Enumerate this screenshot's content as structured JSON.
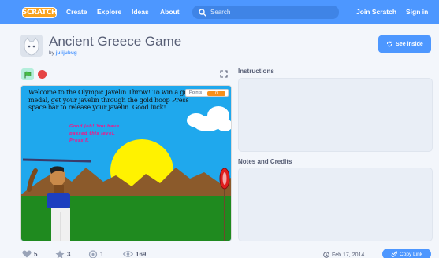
{
  "nav": {
    "logo": "SCRATCH",
    "links": [
      "Create",
      "Explore",
      "Ideas",
      "About"
    ],
    "search_placeholder": "Search",
    "join": "Join Scratch",
    "signin": "Sign in"
  },
  "project": {
    "title": "Ancient Greece Game",
    "by_prefix": "by",
    "author": "julijubug",
    "see_inside": "See inside"
  },
  "stage": {
    "game_text": "Welcome to the Olympic Javelin Throw! To win a gold medal, get your javelin through the gold hoop Press space bar to release your javelin. Good luck!",
    "message_lines": [
      "Good job! You have",
      "passed this level.",
      "Press F."
    ],
    "points_label": "Points",
    "points_value": "0"
  },
  "sidebar": {
    "instructions_title": "Instructions",
    "notes_title": "Notes and Credits"
  },
  "stats": {
    "loves": "5",
    "favorites": "3",
    "remixes": "1",
    "views": "169",
    "date": "Feb 17, 2014",
    "copy_link": "Copy Link"
  },
  "colors": {
    "brand_blue": "#4d97ff",
    "logo_orange": "#f9a21e",
    "panel": "#e9eef6",
    "sky": "#1fa8ed",
    "grass": "#1f8a1f",
    "sun": "#fff200",
    "mountains": "#8b5a2b"
  },
  "icons": [
    "search-icon",
    "see-inside-icon",
    "green-flag-icon",
    "stop-icon",
    "fullscreen-icon",
    "heart-icon",
    "star-icon",
    "remix-icon",
    "eye-icon",
    "clock-icon",
    "link-icon"
  ]
}
